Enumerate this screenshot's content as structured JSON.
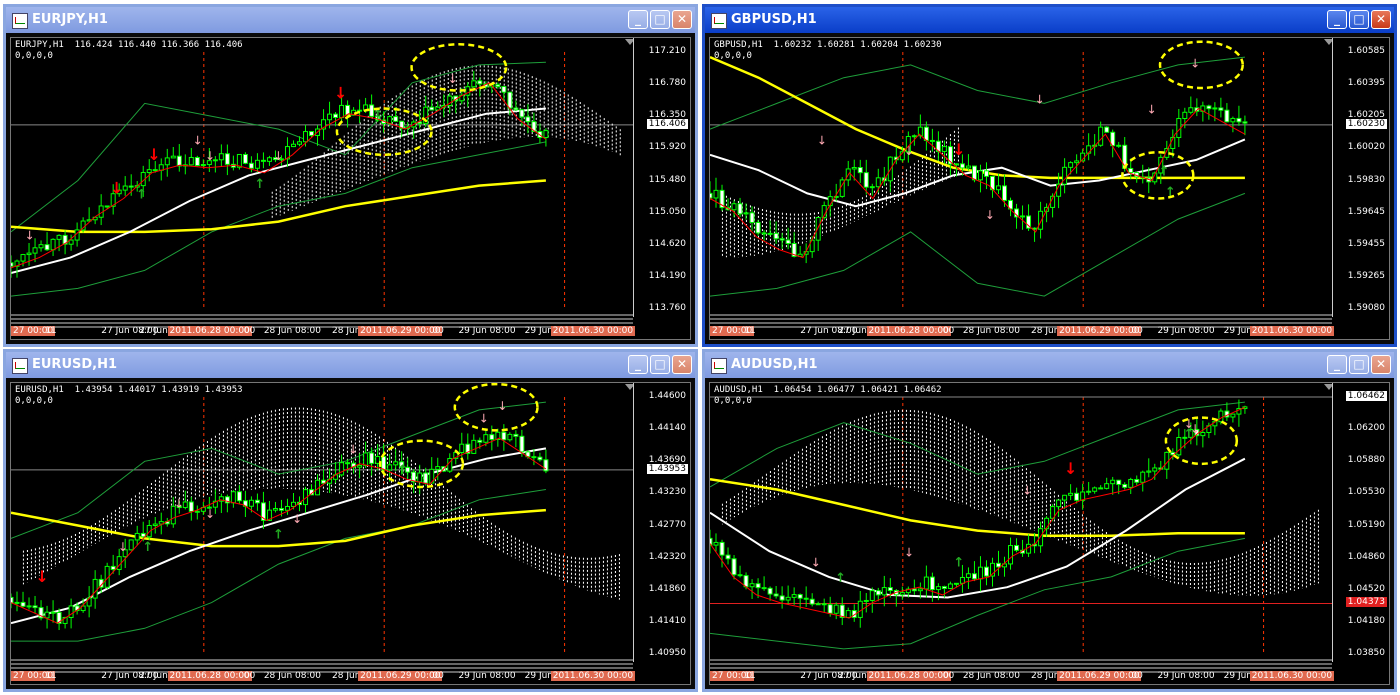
{
  "windows": [
    {
      "title": "EURJPY,H1",
      "active": false,
      "info_line": "EURJPY,H1  116.424 116.440 116.366 116.406",
      "info_line2": "0,0,0,0",
      "price_ticks": [
        "117.210",
        "116.780",
        "116.350",
        "115.920",
        "115.480",
        "115.050",
        "114.620",
        "114.190",
        "113.760"
      ],
      "current_price": "116.406",
      "current_price_style": "white",
      "time_ticks": [
        "27 00:00",
        "11",
        "27 Jun 08:00",
        "27 Jun",
        "2011.06.28 00:00",
        "00",
        "28 Jun 08:00",
        "28 Jun",
        "2011.06.29 00:00",
        "00",
        "29 Jun 08:00",
        "29 Jun",
        "2011.06.30 00:00"
      ]
    },
    {
      "title": "GBPUSD,H1",
      "active": true,
      "info_line": "GBPUSD,H1  1.60232 1.60281 1.60204 1.60230",
      "info_line2": "0,0,0,0",
      "price_ticks": [
        "1.60585",
        "1.60395",
        "1.60205",
        "1.60020",
        "1.59830",
        "1.59645",
        "1.59455",
        "1.59265",
        "1.59080"
      ],
      "current_price": "1.60230",
      "current_price_style": "white",
      "time_ticks": [
        "27 00:00",
        "11",
        "27 Jun 08:00",
        "27 Jun",
        "2011.06.28 00:00",
        "00",
        "28 Jun 08:00",
        "28 Jun",
        "2011.06.29 00:00",
        "00",
        "29 Jun 08:00",
        "29 Jun",
        "2011.06.30 00:00"
      ]
    },
    {
      "title": "EURUSD,H1",
      "active": false,
      "info_line": "EURUSD,H1  1.43954 1.44017 1.43919 1.43953",
      "info_line2": "0,0,0,0",
      "price_ticks": [
        "1.44600",
        "1.44140",
        "1.43690",
        "1.43230",
        "1.42770",
        "1.42320",
        "1.41860",
        "1.41410",
        "1.40950"
      ],
      "current_price": "1.43953",
      "current_price_style": "white",
      "time_ticks": [
        "27 00:00",
        "11",
        "27 Jun 08:00",
        "27 Jun",
        "2011.06.28 00:00",
        "00",
        "28 Jun 08:00",
        "28 Jun",
        "2011.06.29 00:00",
        "00",
        "29 Jun 08:00",
        "29 Jun",
        "2011.06.30 00:00"
      ]
    },
    {
      "title": "AUDUSD,H1",
      "active": false,
      "info_line": "AUDUSD,H1  1.06454 1.06477 1.06421 1.06462",
      "info_line2": "0,0,0,0",
      "price_ticks": [
        "1.06540",
        "1.06200",
        "1.05880",
        "1.05530",
        "1.05190",
        "1.04860",
        "1.04520",
        "1.04180",
        "1.03850"
      ],
      "current_price": "1.06462",
      "current_price_style": "white",
      "extra_price_label": "1.04373",
      "time_ticks": [
        "27 00:00",
        "11",
        "27 Jun 08:00",
        "27 Jun",
        "2011.06.28 00:00",
        "00",
        "28 Jun 08:00",
        "28 Jun",
        "2011.06.29 00:00",
        "00",
        "29 Jun 08:00",
        "29 Jun",
        "2011.06.30 00:00"
      ]
    }
  ],
  "buttons": {
    "minimize": "_",
    "maximize": "□",
    "close": "✕"
  },
  "colors": {
    "candle_up": "#00ff00",
    "candle_down_fill": "#ffffff",
    "bollinger": "#1e9e3a",
    "ma_yellow": "#ffff00",
    "ma_white": "#ffffff",
    "ma_red": "#ff0000",
    "ma_orange": "#ff8c00",
    "cloud": "#ffffff",
    "marker_pink": "#ffaab4",
    "marker_red": "#ff0000",
    "marker_green": "#22aa22",
    "highlight_circle": "#ffff00",
    "separator": "#ff3300"
  },
  "icons": [
    "mt4-chart-icon",
    "minimize-icon",
    "maximize-icon",
    "close-icon"
  ]
}
